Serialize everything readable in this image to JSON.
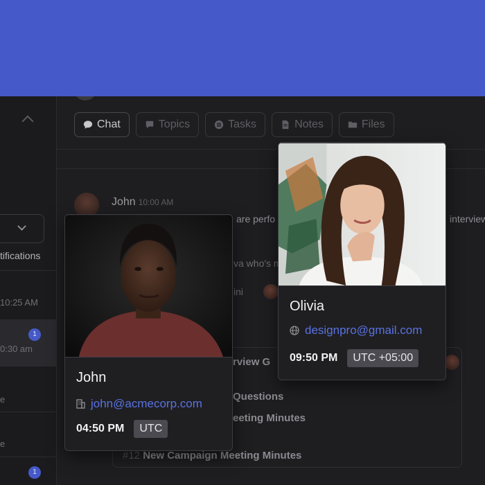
{
  "sidebar": {
    "notifications_label": "tifications",
    "times": [
      "10:25 AM",
      "0:30 am"
    ],
    "badges": [
      "1",
      "1"
    ],
    "letters": [
      "e",
      "e"
    ]
  },
  "tabs": [
    {
      "label": "Chat",
      "icon": "chat-bubble-icon"
    },
    {
      "label": "Topics",
      "icon": "comment-icon"
    },
    {
      "label": "Tasks",
      "icon": "list-icon"
    },
    {
      "label": "Notes",
      "icon": "document-icon"
    },
    {
      "label": "Files",
      "icon": "folder-icon"
    }
  ],
  "message": {
    "author": "John",
    "time": "10:00 AM",
    "snippets": [
      "are perfo",
      "interviews",
      "va who's m",
      "ini"
    ]
  },
  "list": [
    {
      "title": "rview G"
    },
    {
      "title": "Questions"
    },
    {
      "title": "eeting Minutes"
    },
    {
      "num": "#12",
      "title": "New Campaign Meeting Minutes"
    }
  ],
  "cards": {
    "john": {
      "name": "John",
      "email": "john@acmecorp.com",
      "email_icon": "building-icon",
      "time": "04:50 PM",
      "timezone": "UTC"
    },
    "olivia": {
      "name": "Olivia",
      "email": "designpro@gmail.com",
      "email_icon": "globe-icon",
      "time": "09:50 PM",
      "timezone": "UTC +05:00"
    }
  },
  "colors": {
    "accent": "#4659c8",
    "link": "#5a72e0",
    "background": "#1e1e21"
  }
}
